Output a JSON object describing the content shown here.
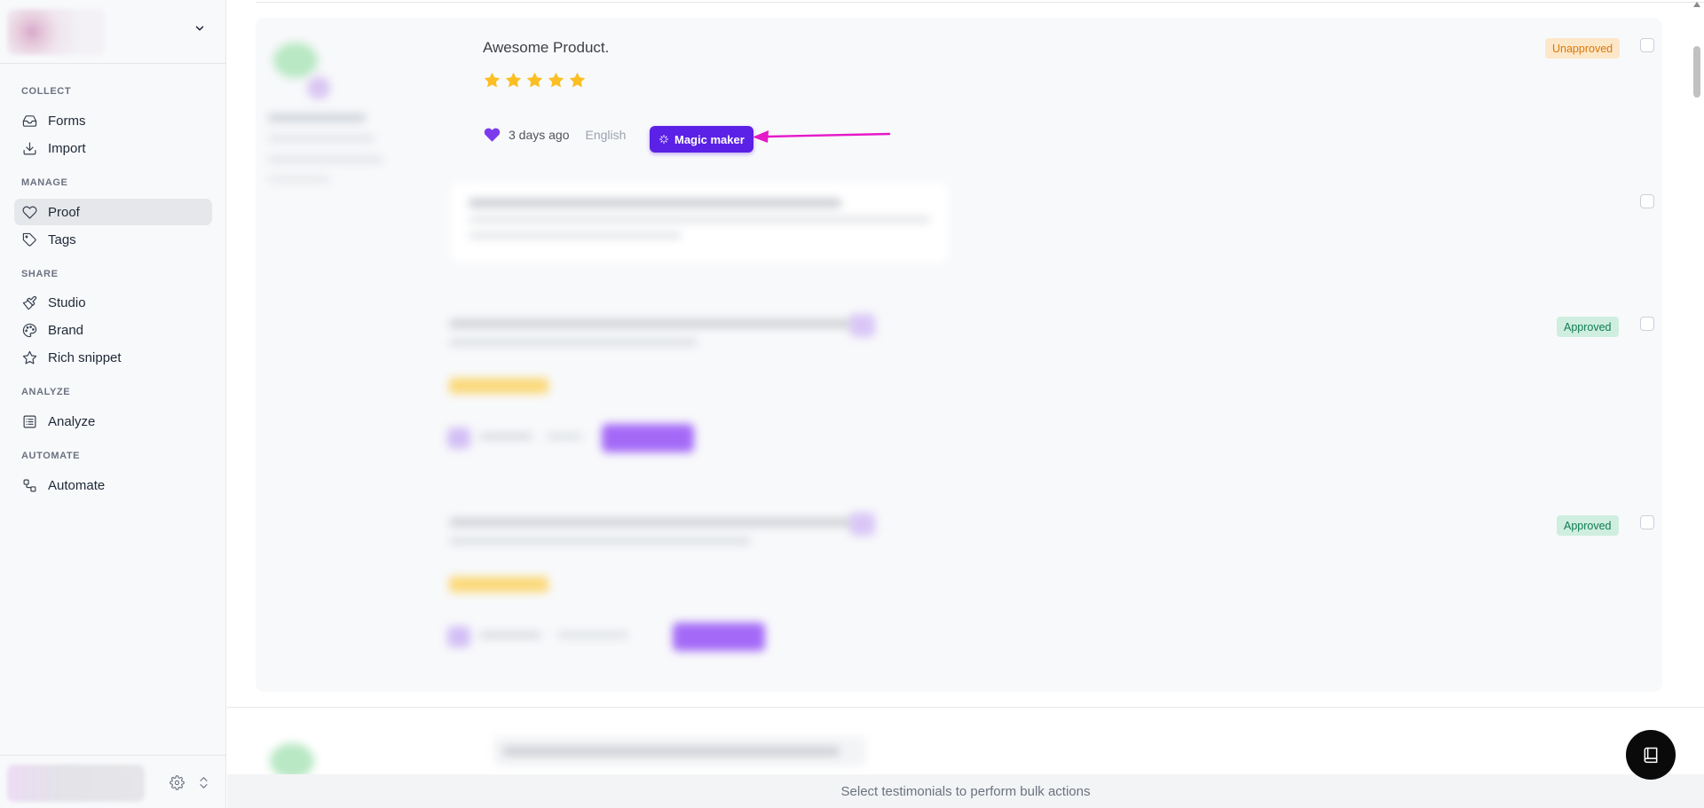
{
  "sidebar": {
    "sections": [
      {
        "label": "COLLECT",
        "items": [
          {
            "label": "Forms",
            "icon": "inbox-icon"
          },
          {
            "label": "Import",
            "icon": "import-icon"
          }
        ]
      },
      {
        "label": "MANAGE",
        "items": [
          {
            "label": "Proof",
            "icon": "heart-icon",
            "active": true
          },
          {
            "label": "Tags",
            "icon": "tag-icon"
          }
        ]
      },
      {
        "label": "SHARE",
        "items": [
          {
            "label": "Studio",
            "icon": "brush-icon"
          },
          {
            "label": "Brand",
            "icon": "palette-icon"
          },
          {
            "label": "Rich snippet",
            "icon": "star-icon"
          }
        ]
      },
      {
        "label": "ANALYZE",
        "items": [
          {
            "label": "Analyze",
            "icon": "list-icon"
          }
        ]
      },
      {
        "label": "AUTOMATE",
        "items": [
          {
            "label": "Automate",
            "icon": "workflow-icon"
          }
        ]
      }
    ]
  },
  "testimonial": {
    "title": "Awesome Product.",
    "rating": 5,
    "time": "3 days ago",
    "language": "English",
    "magic_label": "Magic maker",
    "status": "Unapproved"
  },
  "other_statuses": [
    "Approved",
    "Approved"
  ],
  "bulk_text": "Select testimonials to perform bulk actions",
  "colors": {
    "accent": "#5b21e6",
    "annotation_arrow": "#e619c8",
    "star": "#fbbf24",
    "heart": "#7c3aed"
  }
}
